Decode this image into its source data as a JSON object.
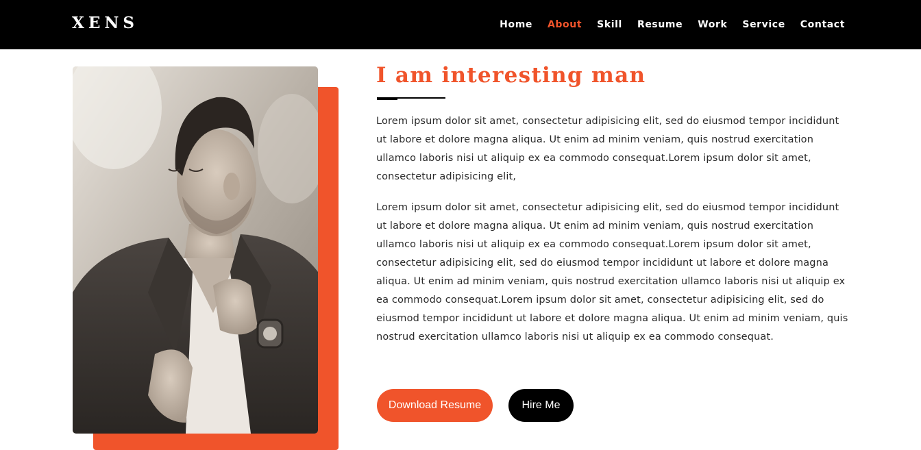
{
  "brand": {
    "logo_text": "XENS"
  },
  "nav": {
    "items": [
      {
        "label": "Home",
        "active": false
      },
      {
        "label": "About",
        "active": true
      },
      {
        "label": "Skill",
        "active": false
      },
      {
        "label": "Resume",
        "active": false
      },
      {
        "label": "Work",
        "active": false
      },
      {
        "label": "Service",
        "active": false
      },
      {
        "label": "Contact",
        "active": false
      }
    ]
  },
  "about": {
    "heading": "I am interesting man",
    "paragraphs": [
      "Lorem ipsum dolor sit amet, consectetur adipisicing elit, sed do eiusmod tempor incididunt ut labore et dolore magna aliqua. Ut enim ad minim veniam, quis nostrud exercitation ullamco laboris nisi ut aliquip ex ea commodo consequat.Lorem ipsum dolor sit amet, consectetur adipisicing elit,",
      "Lorem ipsum dolor sit amet, consectetur adipisicing elit, sed do eiusmod tempor incididunt ut labore et dolore magna aliqua. Ut enim ad minim veniam, quis nostrud exercitation ullamco laboris nisi ut aliquip ex ea commodo consequat.Lorem ipsum dolor sit amet, consectetur adipisicing elit, sed do eiusmod tempor incididunt ut labore et dolore magna aliqua. Ut enim ad minim veniam, quis nostrud exercitation ullamco laboris nisi ut aliquip ex ea commodo consequat.Lorem ipsum dolor sit amet, consectetur adipisicing elit, sed do eiusmod tempor incididunt ut labore et dolore magna aliqua. Ut enim ad minim veniam, quis nostrud exercitation ullamco laboris nisi ut aliquip ex ea commodo consequat."
    ],
    "buttons": {
      "download_label": "Download Resume",
      "hire_label": "Hire Me"
    }
  },
  "colors": {
    "accent": "#f0542b",
    "navbar_bg": "#000000",
    "text": "#2a2a2a"
  }
}
